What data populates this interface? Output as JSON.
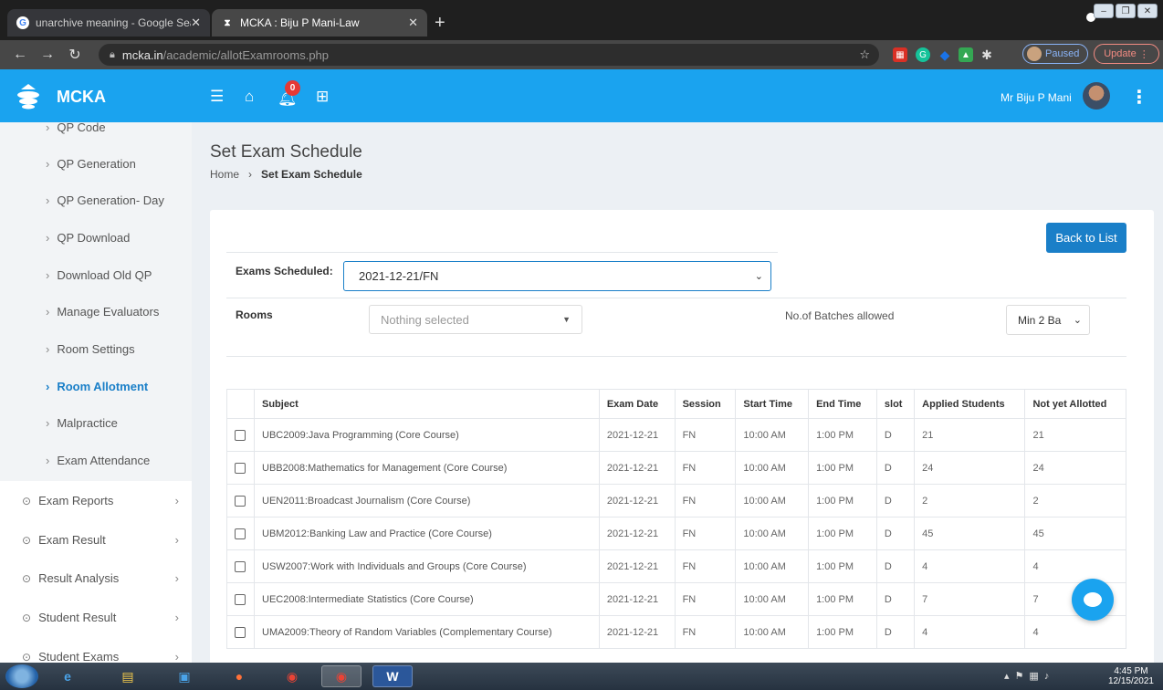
{
  "browser": {
    "tabs": [
      {
        "label": "unarchive meaning - Google Sea",
        "icon": "google-icon"
      },
      {
        "label": "MCKA : Biju P Mani-Law",
        "icon": "mcka-icon"
      }
    ],
    "url_host": "mcka.in",
    "url_path": "/academic/allotExamrooms.php",
    "paused_label": "Paused",
    "update_label": "Update"
  },
  "header": {
    "brand": "MCKA",
    "notification_count": "0",
    "user_name": "Mr Biju P Mani"
  },
  "sidebar": {
    "partial_top": "QP Code",
    "sub_items": [
      {
        "label": "QP Generation",
        "active": false
      },
      {
        "label": "QP Generation- Day",
        "active": false
      },
      {
        "label": "QP Download",
        "active": false
      },
      {
        "label": "Download Old QP",
        "active": false
      },
      {
        "label": "Manage Evaluators",
        "active": false
      },
      {
        "label": "Room Settings",
        "active": false
      },
      {
        "label": "Room Allotment",
        "active": true
      },
      {
        "label": "Malpractice",
        "active": false
      },
      {
        "label": "Exam Attendance",
        "active": false
      }
    ],
    "menu_items": [
      "Exam Reports",
      "Exam Result",
      "Result Analysis",
      "Student Result",
      "Student Exams"
    ]
  },
  "page": {
    "title": "Set Exam Schedule",
    "breadcrumb_home": "Home",
    "breadcrumb_current": "Set Exam Schedule",
    "back_button": "Back to List",
    "exams_scheduled_label": "Exams Scheduled:",
    "exams_scheduled_value": "2021-12-21/FN",
    "rooms_label": "Rooms",
    "rooms_placeholder": "Nothing selected",
    "batches_label": "No.of Batches allowed",
    "batches_value": "Min 2 Ba"
  },
  "table": {
    "headers": [
      "Subject",
      "Exam Date",
      "Session",
      "Start Time",
      "End Time",
      "slot",
      "Applied Students",
      "Not yet Allotted"
    ],
    "rows": [
      [
        "UBC2009:Java Programming (Core Course)",
        "2021-12-21",
        "FN",
        "10:00 AM",
        "1:00 PM",
        "D",
        "21",
        "21"
      ],
      [
        "UBB2008:Mathematics for Management (Core Course)",
        "2021-12-21",
        "FN",
        "10:00 AM",
        "1:00 PM",
        "D",
        "24",
        "24"
      ],
      [
        "UEN2011:Broadcast Journalism (Core Course)",
        "2021-12-21",
        "FN",
        "10:00 AM",
        "1:00 PM",
        "D",
        "2",
        "2"
      ],
      [
        "UBM2012:Banking Law and Practice (Core Course)",
        "2021-12-21",
        "FN",
        "10:00 AM",
        "1:00 PM",
        "D",
        "45",
        "45"
      ],
      [
        "USW2007:Work with Individuals and Groups (Core Course)",
        "2021-12-21",
        "FN",
        "10:00 AM",
        "1:00 PM",
        "D",
        "4",
        "4"
      ],
      [
        "UEC2008:Intermediate Statistics (Core Course)",
        "2021-12-21",
        "FN",
        "10:00 AM",
        "1:00 PM",
        "D",
        "7",
        "7"
      ],
      [
        "UMA2009:Theory of Random Variables (Complementary Course)",
        "2021-12-21",
        "FN",
        "10:00 AM",
        "1:00 PM",
        "D",
        "4",
        "4"
      ]
    ]
  },
  "taskbar": {
    "time": "4:45 PM",
    "date": "12/15/2021"
  },
  "colors": {
    "header_blue": "#1aa3ef",
    "accent_blue": "#1a7fc8"
  }
}
